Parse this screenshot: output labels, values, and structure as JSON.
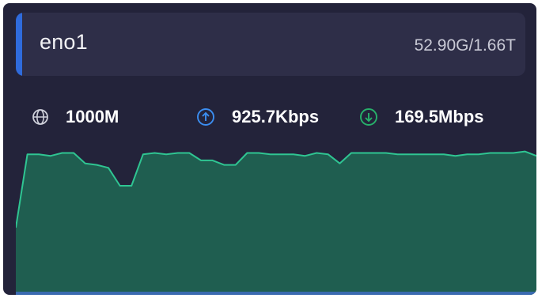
{
  "interface": {
    "name": "eno1",
    "usage": "52.90G/1.66T",
    "accent_color": "#2f6bdc"
  },
  "stats": {
    "link_speed": "1000M",
    "upload": "925.7Kbps",
    "download": "169.5Mbps",
    "link_icon": "globe-icon",
    "upload_icon": "arrow-up-circle-icon",
    "download_icon": "arrow-down-circle-icon",
    "upload_color": "#3b8df0",
    "download_color": "#27b06a"
  },
  "chart_data": {
    "type": "area",
    "title": "",
    "xlabel": "",
    "ylabel": "",
    "ylim": [
      0,
      1
    ],
    "grid": false,
    "fill_color": "#1f5e50",
    "line_color": "#2fc592",
    "values": [
      0.45,
      0.94,
      0.94,
      0.93,
      0.95,
      0.95,
      0.88,
      0.87,
      0.85,
      0.73,
      0.73,
      0.94,
      0.95,
      0.94,
      0.95,
      0.95,
      0.9,
      0.9,
      0.87,
      0.87,
      0.95,
      0.95,
      0.94,
      0.94,
      0.94,
      0.93,
      0.95,
      0.94,
      0.88,
      0.95,
      0.95,
      0.95,
      0.95,
      0.94,
      0.94,
      0.94,
      0.94,
      0.94,
      0.93,
      0.94,
      0.94,
      0.95,
      0.95,
      0.95,
      0.96,
      0.93
    ]
  }
}
